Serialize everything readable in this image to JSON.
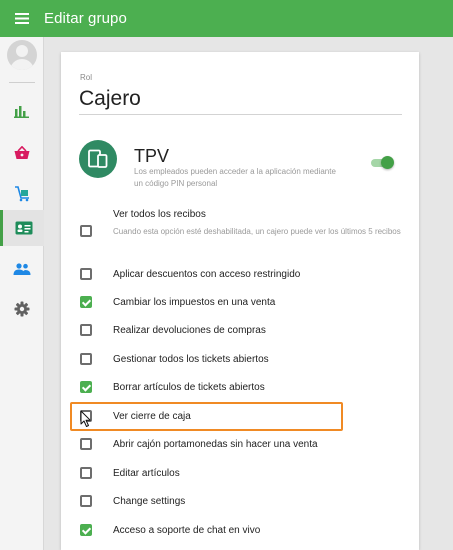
{
  "appbar": {
    "title": "Editar grupo",
    "menu_icon": "menu-icon",
    "color": "#4caf50"
  },
  "rail": {
    "avatar_icon": "avatar-icon",
    "items": [
      {
        "icon": "bar-chart-icon",
        "active": false
      },
      {
        "icon": "basket-icon",
        "active": false
      },
      {
        "icon": "inventory-cart-icon",
        "active": false
      },
      {
        "icon": "employees-badge-icon",
        "active": true
      },
      {
        "icon": "customers-icon",
        "active": false
      },
      {
        "icon": "settings-icon",
        "active": false
      }
    ]
  },
  "role": {
    "label": "Rol",
    "value": "Cajero"
  },
  "tpv": {
    "title": "TPV",
    "description": "Los empleados pueden acceder a la aplicación mediante un código PIN personal",
    "enabled": true,
    "icon": "devices-icon",
    "accent": "#2f8a63"
  },
  "permissions": [
    {
      "label": "Ver todos los recibos",
      "description": "Cuando esta opción esté deshabilitada, un cajero puede ver los últimos 5 recibos",
      "checked": false
    },
    {
      "label": "Aplicar descuentos con acceso restringido",
      "checked": false
    },
    {
      "label": "Cambiar los impuestos en una venta",
      "checked": true
    },
    {
      "label": "Realizar devoluciones de compras",
      "checked": false
    },
    {
      "label": "Gestionar todos los tickets abiertos",
      "checked": false
    },
    {
      "label": "Borrar artículos de tickets abiertos",
      "checked": true
    },
    {
      "label": "Ver cierre de caja",
      "checked": false,
      "highlighted": true
    },
    {
      "label": "Abrir cajón portamonedas sin hacer una venta",
      "checked": false
    },
    {
      "label": "Editar artículos",
      "checked": false
    },
    {
      "label": "Change settings",
      "checked": false
    },
    {
      "label": "Acceso a soporte de chat en vivo",
      "checked": true
    }
  ],
  "highlight_color": "#f08a24"
}
